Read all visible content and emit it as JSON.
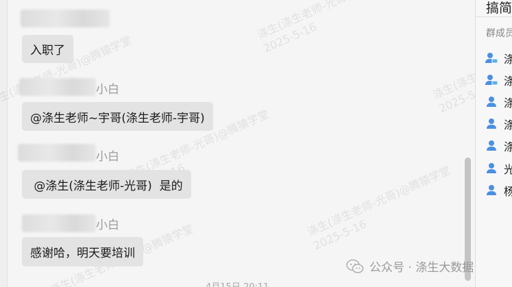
{
  "messages": [
    {
      "sender_suffix": "",
      "text": "入职了"
    },
    {
      "sender_suffix": "小白",
      "text": "@涤生老师~宇哥(涤生老师-宇哥)"
    },
    {
      "sender_suffix": "小白",
      "text": " @涤生(涤生老师-光哥)  是的"
    },
    {
      "sender_suffix": "小白",
      "text": "感谢哈，明天要培训"
    }
  ],
  "watermarks": [
    "涤生(涤生老师-光哥)@腾猿学堂",
    "2025-5-16"
  ],
  "timestamp": "4月15日 20:11",
  "sidebar": {
    "title": "搞简",
    "section_label": "群成员",
    "members": [
      {
        "name": "涤",
        "icon": "member-device-icon"
      },
      {
        "name": "涤",
        "icon": "member-device-icon"
      },
      {
        "name": "涤",
        "icon": "member-icon"
      },
      {
        "name": "涤",
        "icon": "member-icon"
      },
      {
        "name": "涤",
        "icon": "member-icon"
      },
      {
        "name": "光",
        "icon": "member-icon"
      },
      {
        "name": "杨",
        "icon": "member-icon"
      }
    ]
  },
  "footer_watermark": "公众号 · 涤生大数据",
  "colors": {
    "bubble": "#e3e3e3",
    "member_icon": "#4a90e2"
  }
}
